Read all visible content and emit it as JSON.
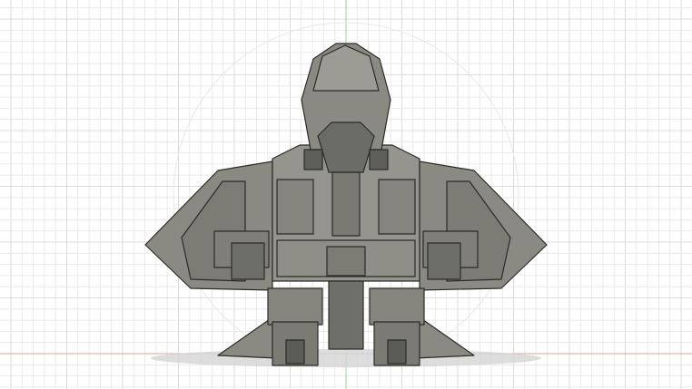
{
  "viewport": {
    "view": "front",
    "colors": {
      "background": "#ffffff",
      "grid_minor": "#e6e6e6",
      "grid_major": "#d2d2d2",
      "axis_y": "#7fd07f",
      "axis_x": "#e08a8a",
      "model_fill": "#8a8a82",
      "model_dark": "#5e5e58",
      "model_light": "#a3a39b",
      "edge": "#2b2b28"
    }
  }
}
